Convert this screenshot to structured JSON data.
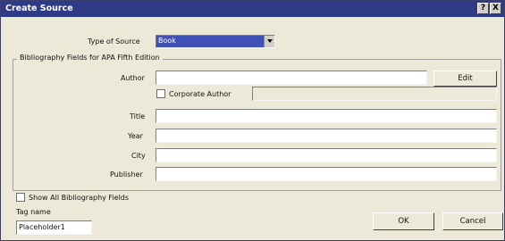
{
  "window": {
    "title": "Create Source",
    "help_label": "?",
    "close_label": "X"
  },
  "source_type": {
    "label": "Type of Source",
    "label_underline_char": "S",
    "value": "Book"
  },
  "fields_group": {
    "title": "Bibliography Fields for APA Fifth Edition"
  },
  "author": {
    "label": "Author",
    "value": "",
    "edit_label": "Edit"
  },
  "corporate_author": {
    "label": "Corporate Author",
    "checked": false,
    "value": ""
  },
  "fields": [
    {
      "label": "Title",
      "value": ""
    },
    {
      "label": "Year",
      "value": ""
    },
    {
      "label": "City",
      "value": ""
    },
    {
      "label": "Publisher",
      "value": ""
    }
  ],
  "show_all": {
    "label": "Show All Bibliography Fields",
    "underline_char": "A",
    "checked": false
  },
  "tag": {
    "label": "Tag name",
    "underline_char": "T",
    "value": "Placeholder1"
  },
  "buttons": {
    "ok": "OK",
    "cancel": "Cancel"
  }
}
